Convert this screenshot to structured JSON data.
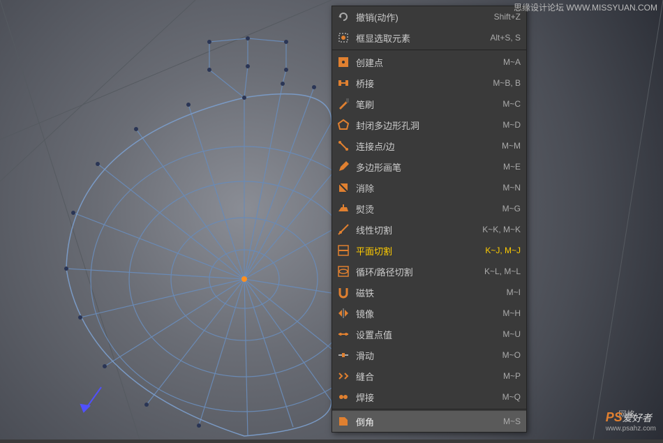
{
  "watermark": {
    "top": "思缘设计论坛 WWW.MISSYUAN.COM",
    "bottom_prefix": "PS",
    "bottom_text": "爱好者",
    "bottom_url": "www.psahz.com"
  },
  "status": "网格",
  "menu": {
    "items": [
      {
        "icon": "undo",
        "label": "撤销(动作)",
        "shortcut": "Shift+Z",
        "highlighted": false
      },
      {
        "icon": "frame-select",
        "label": "框显选取元素",
        "shortcut": "Alt+S, S",
        "highlighted": false
      },
      {
        "divider": true
      },
      {
        "icon": "create-point",
        "label": "创建点",
        "shortcut": "M~A",
        "highlighted": false
      },
      {
        "icon": "bridge",
        "label": "桥接",
        "shortcut": "M~B, B",
        "highlighted": false
      },
      {
        "icon": "brush",
        "label": "笔刷",
        "shortcut": "M~C",
        "highlighted": false
      },
      {
        "icon": "close-hole",
        "label": "封闭多边形孔洞",
        "shortcut": "M~D",
        "highlighted": false
      },
      {
        "icon": "connect",
        "label": "连接点/边",
        "shortcut": "M~M",
        "highlighted": false
      },
      {
        "icon": "poly-pen",
        "label": "多边形画笔",
        "shortcut": "M~E",
        "highlighted": false
      },
      {
        "icon": "dissolve",
        "label": "消除",
        "shortcut": "M~N",
        "highlighted": false
      },
      {
        "icon": "iron",
        "label": "熨烫",
        "shortcut": "M~G",
        "highlighted": false
      },
      {
        "icon": "line-cut",
        "label": "线性切割",
        "shortcut": "K~K, M~K",
        "highlighted": false
      },
      {
        "icon": "plane-cut",
        "label": "平面切割",
        "shortcut": "K~J, M~J",
        "highlighted": true
      },
      {
        "icon": "loop-cut",
        "label": "循环/路径切割",
        "shortcut": "K~L, M~L",
        "highlighted": false
      },
      {
        "icon": "magnet",
        "label": "磁铁",
        "shortcut": "M~I",
        "highlighted": false
      },
      {
        "icon": "mirror",
        "label": "镜像",
        "shortcut": "M~H",
        "highlighted": false
      },
      {
        "icon": "set-point",
        "label": "设置点值",
        "shortcut": "M~U",
        "highlighted": false
      },
      {
        "icon": "slide",
        "label": "滑动",
        "shortcut": "M~O",
        "highlighted": false
      },
      {
        "icon": "stitch",
        "label": "缝合",
        "shortcut": "M~P",
        "highlighted": false
      },
      {
        "icon": "weld",
        "label": "焊接",
        "shortcut": "M~Q",
        "highlighted": false
      },
      {
        "divider": true
      },
      {
        "icon": "bevel",
        "label": "倒角",
        "shortcut": "M~S",
        "highlighted": false,
        "selected": true
      }
    ]
  }
}
